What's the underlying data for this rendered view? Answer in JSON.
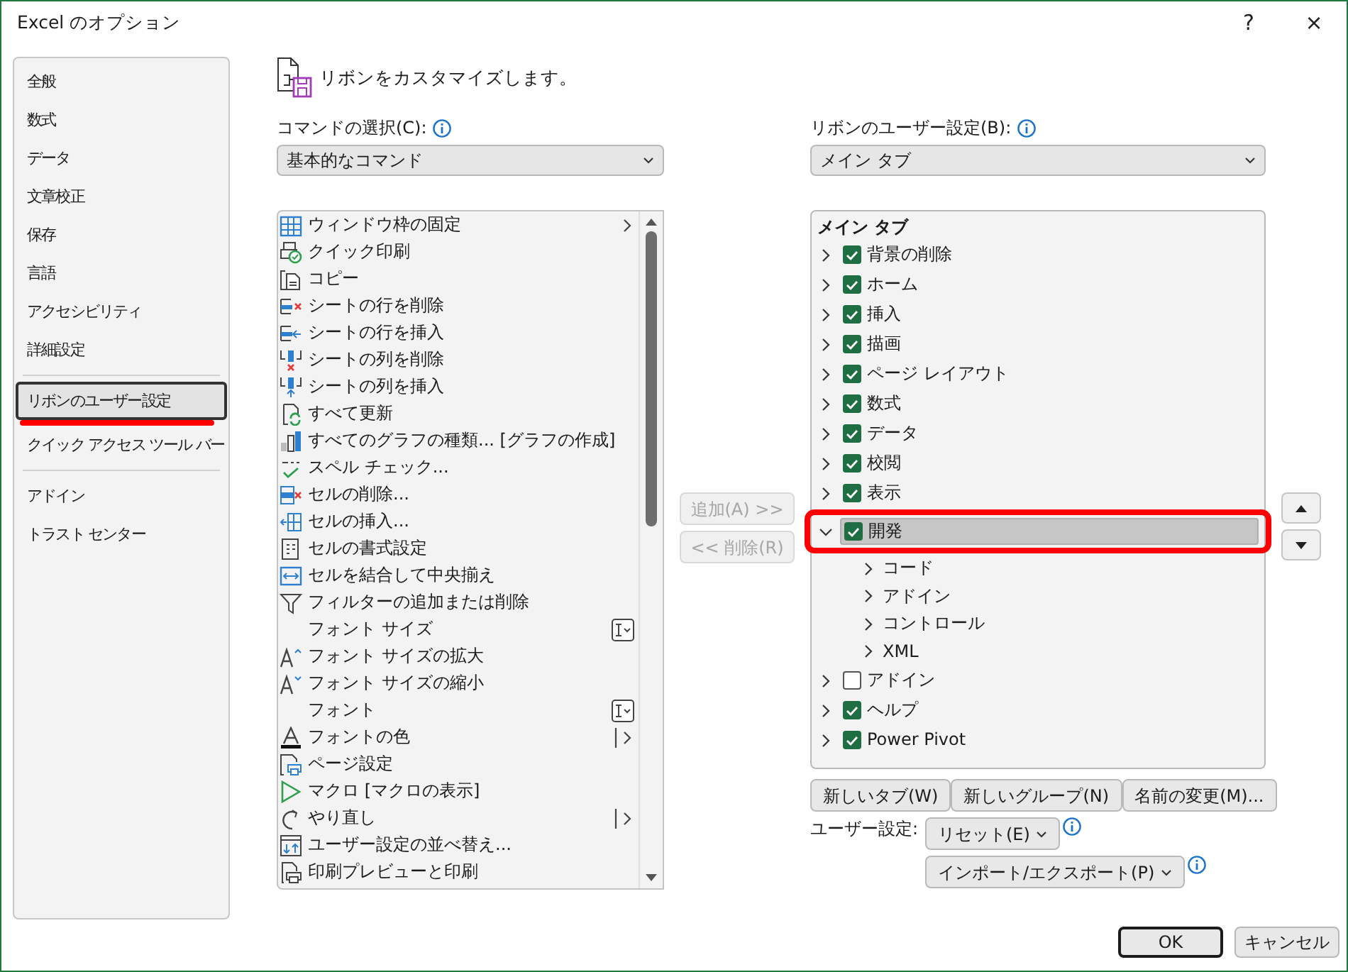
{
  "window": {
    "title": "Excel のオプション",
    "help": "?",
    "close": "×"
  },
  "nav": {
    "groups": [
      [
        {
          "label": "全般",
          "selected": false,
          "underlined": false
        },
        {
          "label": "数式",
          "selected": false,
          "underlined": false
        },
        {
          "label": "データ",
          "selected": false,
          "underlined": false
        },
        {
          "label": "文章校正",
          "selected": false,
          "underlined": false
        },
        {
          "label": "保存",
          "selected": false,
          "underlined": false
        },
        {
          "label": "言語",
          "selected": false,
          "underlined": false
        },
        {
          "label": "アクセシビリティ",
          "selected": false,
          "underlined": false
        },
        {
          "label": "詳細設定",
          "selected": false,
          "underlined": false
        }
      ],
      [
        {
          "label": "リボンのユーザー設定",
          "selected": true,
          "underlined": true
        },
        {
          "label": "クイック アクセス ツール バー",
          "selected": false,
          "underlined": false
        }
      ],
      [
        {
          "label": "アドイン",
          "selected": false,
          "underlined": false
        },
        {
          "label": "トラスト センター",
          "selected": false,
          "underlined": false
        }
      ]
    ]
  },
  "heading": "リボンをカスタマイズします。",
  "commands": {
    "label": "コマンドの選択(C):",
    "dropdown": "基本的なコマンド",
    "items": [
      {
        "label": "ウィンドウ枠の固定",
        "kind": "submenu"
      },
      {
        "label": "クイック印刷",
        "kind": "plain"
      },
      {
        "label": "コピー",
        "kind": "plain"
      },
      {
        "label": "シートの行を削除",
        "kind": "plain"
      },
      {
        "label": "シートの行を挿入",
        "kind": "plain"
      },
      {
        "label": "シートの列を削除",
        "kind": "plain"
      },
      {
        "label": "シートの列を挿入",
        "kind": "plain"
      },
      {
        "label": "すべて更新",
        "kind": "plain"
      },
      {
        "label": "すべてのグラフの種類... [グラフの作成]",
        "kind": "plain"
      },
      {
        "label": "スペル チェック...",
        "kind": "plain"
      },
      {
        "label": "セルの削除...",
        "kind": "plain"
      },
      {
        "label": "セルの挿入...",
        "kind": "plain"
      },
      {
        "label": "セルの書式設定",
        "kind": "plain"
      },
      {
        "label": "セルを結合して中央揃え",
        "kind": "plain"
      },
      {
        "label": "フィルターの追加または削除",
        "kind": "plain"
      },
      {
        "label": "フォント サイズ",
        "kind": "combo"
      },
      {
        "label": "フォント サイズの拡大",
        "kind": "plain"
      },
      {
        "label": "フォント サイズの縮小",
        "kind": "plain"
      },
      {
        "label": "フォント",
        "kind": "combo"
      },
      {
        "label": "フォントの色",
        "kind": "split"
      },
      {
        "label": "ページ設定",
        "kind": "plain"
      },
      {
        "label": "マクロ [マクロの表示]",
        "kind": "plain"
      },
      {
        "label": "やり直し",
        "kind": "split"
      },
      {
        "label": "ユーザー設定の並べ替え...",
        "kind": "plain"
      },
      {
        "label": "印刷プレビューと印刷",
        "kind": "plain"
      }
    ]
  },
  "transfer_buttons": [
    {
      "label": "追加(A) >>",
      "disabled": true
    },
    {
      "label": "<< 削除(R)",
      "disabled": true
    }
  ],
  "ribbon": {
    "label": "リボンのユーザー設定(B):",
    "dropdown": "メイン タブ",
    "heading": "メイン タブ",
    "tabs": [
      {
        "label": "背景の削除",
        "checked": true,
        "expanded": false,
        "selected": false,
        "highlighted": false
      },
      {
        "label": "ホーム",
        "checked": true,
        "expanded": false,
        "selected": false,
        "highlighted": false
      },
      {
        "label": "挿入",
        "checked": true,
        "expanded": false,
        "selected": false,
        "highlighted": false
      },
      {
        "label": "描画",
        "checked": true,
        "expanded": false,
        "selected": false,
        "highlighted": false
      },
      {
        "label": "ページ レイアウト",
        "checked": true,
        "expanded": false,
        "selected": false,
        "highlighted": false
      },
      {
        "label": "数式",
        "checked": true,
        "expanded": false,
        "selected": false,
        "highlighted": false
      },
      {
        "label": "データ",
        "checked": true,
        "expanded": false,
        "selected": false,
        "highlighted": false
      },
      {
        "label": "校閲",
        "checked": true,
        "expanded": false,
        "selected": false,
        "highlighted": false
      },
      {
        "label": "表示",
        "checked": true,
        "expanded": false,
        "selected": false,
        "highlighted": false
      },
      {
        "label": "開発",
        "checked": true,
        "expanded": true,
        "selected": true,
        "highlighted": true,
        "children": [
          {
            "label": "コード",
            "expanded": false
          },
          {
            "label": "アドイン",
            "expanded": false
          },
          {
            "label": "コントロール",
            "expanded": false
          },
          {
            "label": "XML",
            "expanded": false
          }
        ]
      },
      {
        "label": "アドイン",
        "checked": false,
        "expanded": false,
        "selected": false,
        "highlighted": false
      },
      {
        "label": "ヘルプ",
        "checked": true,
        "expanded": false,
        "selected": false,
        "highlighted": false
      },
      {
        "label": "Power Pivot",
        "checked": true,
        "expanded": false,
        "selected": false,
        "highlighted": false
      }
    ]
  },
  "ribbon_buttons": [
    "新しいタブ(W)",
    "新しいグループ(N)",
    "名前の変更(M)..."
  ],
  "customizations": {
    "label": "ユーザー設定:",
    "buttons": [
      "リセット(E)",
      "インポート/エクスポート(P)"
    ]
  },
  "dialog_buttons": [
    {
      "label": "OK",
      "default": true
    },
    {
      "label": "キャンセル",
      "default": false
    }
  ]
}
